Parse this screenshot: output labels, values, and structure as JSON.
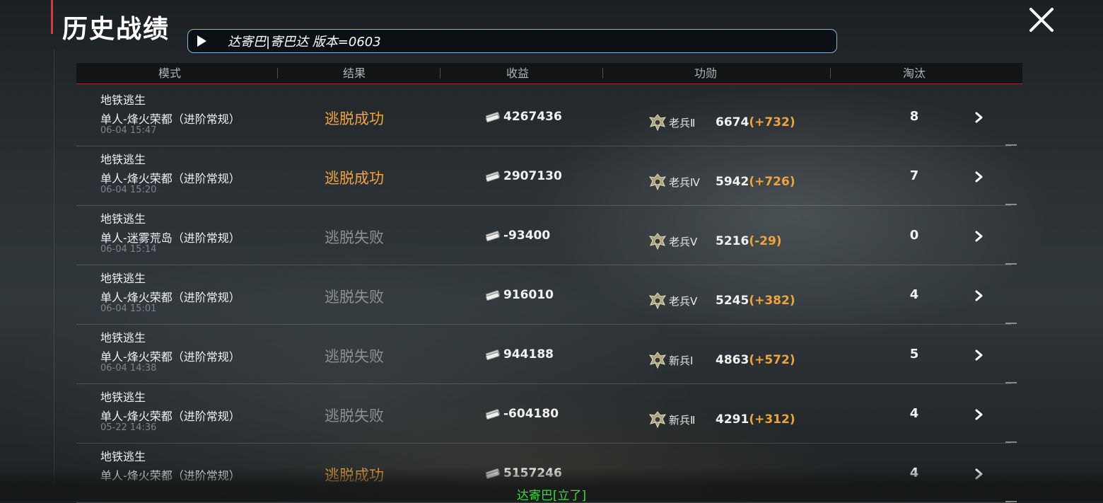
{
  "page": {
    "title": "历史战绩",
    "close_icon": "close-icon"
  },
  "banner": {
    "icon": "play-icon",
    "text": "达寄巴|寄巴达 版本=0603"
  },
  "table": {
    "headers": [
      "模式",
      "结果",
      "收益",
      "功勋",
      "淘汰"
    ],
    "rows": [
      {
        "mode": "地铁逃生",
        "mode_detail": "单人-烽火荣都（进阶常规）",
        "time": "06-04 15:47",
        "result": "逃脱成功",
        "result_status": "success",
        "income": "4267436",
        "rank": "老兵Ⅱ",
        "merit": "6674",
        "merit_delta": "(+732)",
        "kills": "8"
      },
      {
        "mode": "地铁逃生",
        "mode_detail": "单人-烽火荣都（进阶常规）",
        "time": "06-04 15:20",
        "result": "逃脱成功",
        "result_status": "success",
        "income": "2907130",
        "rank": "老兵Ⅳ",
        "merit": "5942",
        "merit_delta": "(+726)",
        "kills": "7"
      },
      {
        "mode": "地铁逃生",
        "mode_detail": "单人-迷雾荒岛（进阶常规）",
        "time": "06-04 15:14",
        "result": "逃脱失败",
        "result_status": "fail",
        "income": "-93400",
        "rank": "老兵Ⅴ",
        "merit": "5216",
        "merit_delta": "(-29)",
        "kills": "0"
      },
      {
        "mode": "地铁逃生",
        "mode_detail": "单人-烽火荣都（进阶常规）",
        "time": "06-04 15:01",
        "result": "逃脱失败",
        "result_status": "fail",
        "income": "916010",
        "rank": "老兵Ⅴ",
        "merit": "5245",
        "merit_delta": "(+382)",
        "kills": "4"
      },
      {
        "mode": "地铁逃生",
        "mode_detail": "单人-烽火荣都（进阶常规）",
        "time": "06-04 14:38",
        "result": "逃脱失败",
        "result_status": "fail",
        "income": "944188",
        "rank": "新兵Ⅰ",
        "merit": "4863",
        "merit_delta": "(+572)",
        "kills": "5"
      },
      {
        "mode": "地铁逃生",
        "mode_detail": "单人-烽火荣都（进阶常规）",
        "time": "05-22 14:36",
        "result": "逃脱失败",
        "result_status": "fail",
        "income": "-604180",
        "rank": "新兵Ⅱ",
        "merit": "4291",
        "merit_delta": "(+312)",
        "kills": "4"
      },
      {
        "mode": "地铁逃生",
        "mode_detail": "单人-烽火荣都（进阶常规）",
        "time": "",
        "result": "逃脱成功",
        "result_status": "success",
        "income": "5157246",
        "rank": "",
        "merit": "",
        "merit_delta": "",
        "kills": "4"
      }
    ]
  },
  "subtitle": "达寄巴[立了]",
  "colors": {
    "success": "#f0a33a",
    "fail": "#8b9094",
    "accent_red": "#d13b3b",
    "subtitle_green": "#33e033"
  }
}
